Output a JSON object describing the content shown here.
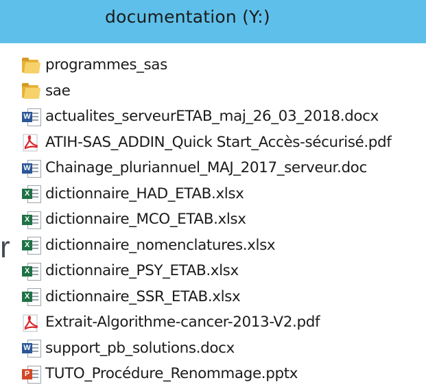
{
  "header": {
    "title": "documentation (Y:)"
  },
  "stray_text": "r",
  "files": [
    {
      "name": "programmes_sas",
      "icon": "folder-icon"
    },
    {
      "name": "sae",
      "icon": "folder-icon"
    },
    {
      "name": "actualites_serveurETAB_maj_26_03_2018.docx",
      "icon": "word-docx-icon"
    },
    {
      "name": "ATIH-SAS_ADDIN_Quick Start_Accès-sécurisé.pdf",
      "icon": "pdf-icon"
    },
    {
      "name": "Chainage_pluriannuel_MAJ_2017_serveur.doc",
      "icon": "word-doc-icon"
    },
    {
      "name": "dictionnaire_HAD_ETAB.xlsx",
      "icon": "excel-icon"
    },
    {
      "name": "dictionnaire_MCO_ETAB.xlsx",
      "icon": "excel-icon"
    },
    {
      "name": "dictionnaire_nomenclatures.xlsx",
      "icon": "excel-icon"
    },
    {
      "name": "dictionnaire_PSY_ETAB.xlsx",
      "icon": "excel-icon"
    },
    {
      "name": "dictionnaire_SSR_ETAB.xlsx",
      "icon": "excel-icon"
    },
    {
      "name": "Extrait-Algorithme-cancer-2013-V2.pdf",
      "icon": "pdf-icon"
    },
    {
      "name": "support_pb_solutions.docx",
      "icon": "word-docx-icon"
    },
    {
      "name": "TUTO_Procédure_Renommage.pptx",
      "icon": "powerpoint-icon"
    }
  ],
  "colors": {
    "header_bg": "#5ec0ea",
    "folder": "#e8b23a",
    "word": "#2b5797",
    "excel": "#1e7145",
    "pdf": "#d9262b",
    "powerpoint": "#d24726"
  }
}
